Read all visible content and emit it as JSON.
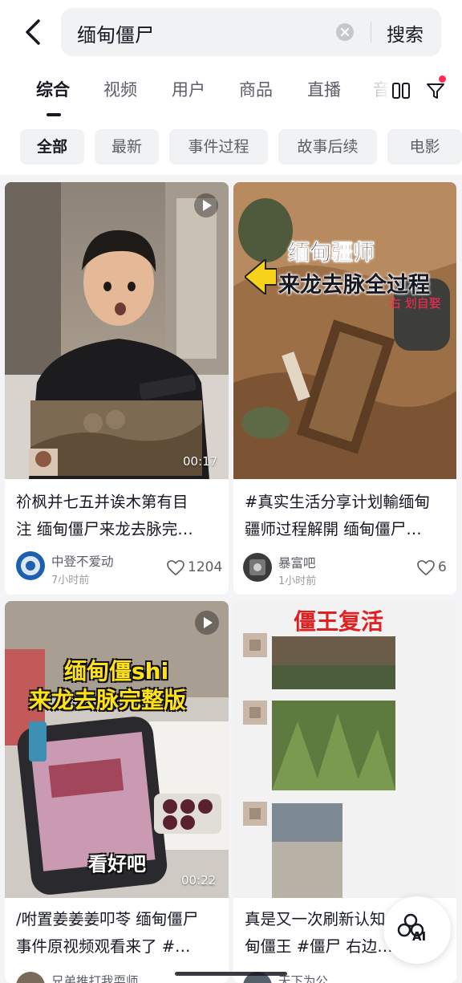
{
  "search": {
    "query": "缅甸僵尸",
    "submit_label": "搜索"
  },
  "tabs": [
    {
      "label": "综合",
      "active": true
    },
    {
      "label": "视频"
    },
    {
      "label": "用户"
    },
    {
      "label": "商品"
    },
    {
      "label": "直播"
    },
    {
      "label": "音"
    }
  ],
  "chips": [
    {
      "label": "全部",
      "active": true
    },
    {
      "label": "最新"
    },
    {
      "label": "事件过程"
    },
    {
      "label": "故事后续"
    },
    {
      "label": "电影"
    }
  ],
  "results": [
    {
      "caption_line1": "祄枫并七五并诶木第有目",
      "caption_line2": "注 缅甸僵尸来龙去脉完…",
      "duration": "00:17",
      "author": "中登不爱动",
      "time": "7小时前",
      "likes": "1204"
    },
    {
      "overlay_line1": "缅甸疆师",
      "overlay_line2": "来龙去脉全过程",
      "overlay_corner": "右 划自娶",
      "caption_line1": "#真实生活分享计划輸缅甸",
      "caption_line2": "疆师过程解開 缅甸僵尸…",
      "author": "暴富吧",
      "time": "1小时前",
      "likes": "6"
    },
    {
      "overlay_line1": "缅甸僵shi",
      "overlay_line2": "来龙去脉完整版",
      "overlay_bottom": "看好吧",
      "duration": "00:22",
      "caption_line1": "/咐置姜姜姜叩苓 缅甸僵尸",
      "caption_line2": "事件原视频观看来了 #…",
      "author": "兄弟推打我耍师"
    },
    {
      "overlay_title": "僵王复活",
      "caption_line1": "真是又一次刷新认知 缅甸",
      "caption_line2": "甸僵王 #僵尸 右边…",
      "author": "天下为公"
    }
  ],
  "ai_button": {
    "label": "AI"
  },
  "colors": {
    "accent_red": "#fe2c55",
    "text_primary": "#161823",
    "text_secondary": "#5b5e66",
    "page_bg": "#f4f4f6"
  }
}
